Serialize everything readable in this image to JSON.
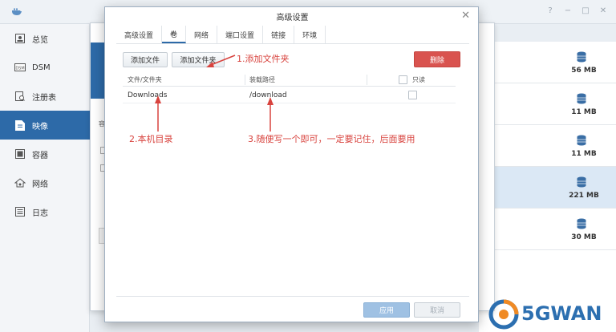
{
  "sidebar": {
    "items": [
      {
        "label": "总览",
        "icon": "overview-icon"
      },
      {
        "label": "DSM",
        "icon": "dsm-icon"
      },
      {
        "label": "注册表",
        "icon": "registry-icon"
      },
      {
        "label": "映像",
        "icon": "image-icon",
        "active": true
      },
      {
        "label": "容器",
        "icon": "container-icon"
      },
      {
        "label": "网络",
        "icon": "network-icon"
      },
      {
        "label": "日志",
        "icon": "log-icon"
      }
    ]
  },
  "window_controls": [
    "?",
    "−",
    "□",
    "✕"
  ],
  "background_window": {
    "fragment_text": "容"
  },
  "right_panel": {
    "sizes": [
      {
        "label": "56 MB",
        "selected": false
      },
      {
        "label": "11 MB",
        "selected": false
      },
      {
        "label": "11 MB",
        "selected": false
      },
      {
        "label": "221 MB",
        "selected": true
      },
      {
        "label": "30 MB",
        "selected": false
      }
    ]
  },
  "dialog": {
    "title": "高级设置",
    "close": "✕",
    "tabs": [
      "高级设置",
      "卷",
      "网络",
      "端口设置",
      "链接",
      "环境"
    ],
    "active_tab": "卷",
    "buttons": {
      "add_file": "添加文件",
      "add_folder": "添加文件夹",
      "delete": "删除",
      "apply": "应用",
      "cancel": "取消"
    },
    "table": {
      "headers": [
        "文件/文件夹",
        "装载路径",
        "只读"
      ],
      "rows": [
        {
          "file": "Downloads",
          "mount_path": "/download",
          "readonly": false
        }
      ]
    }
  },
  "annotations": {
    "a1": "1.添加文件夹",
    "a2": "2.本机目录",
    "a3": "3.随便写一个即可，一定要记住，后面要用"
  },
  "colors": {
    "accent": "#2d6aa8",
    "danger": "#d9534f",
    "annotation": "#d8433e"
  },
  "watermark": {
    "text": "5GWAN"
  }
}
